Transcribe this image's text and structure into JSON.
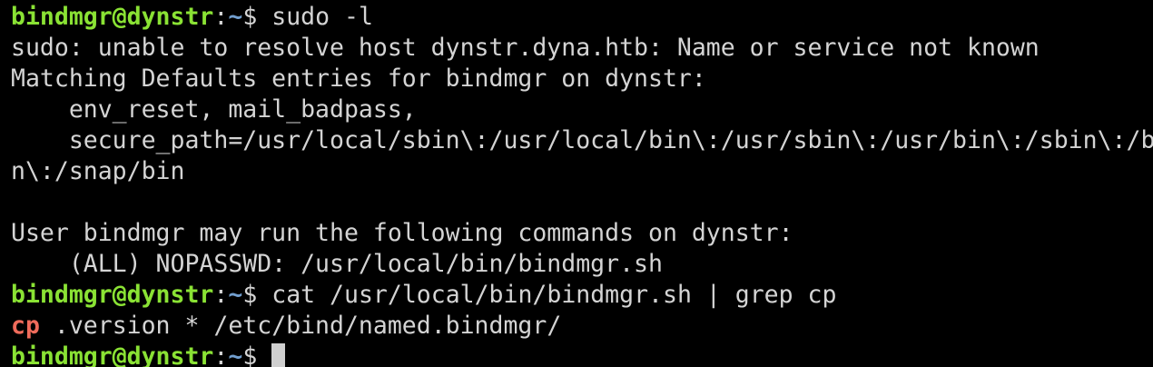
{
  "colors": {
    "background": "#000000",
    "text": "#d4d4d4",
    "prompt_user": "#8ae234",
    "prompt_path": "#729fcf",
    "highlight": "#ef6b5b"
  },
  "prompt": {
    "user_host": "bindmgr@dynstr",
    "colon": ":",
    "path": "~",
    "symbol": "$"
  },
  "lines": [
    {
      "type": "prompt",
      "command": " sudo -l"
    },
    {
      "type": "output",
      "text": "sudo: unable to resolve host dynstr.dyna.htb: Name or service not known"
    },
    {
      "type": "output",
      "text": "Matching Defaults entries for bindmgr on dynstr:"
    },
    {
      "type": "output",
      "text": "    env_reset, mail_badpass,"
    },
    {
      "type": "output",
      "text": "    secure_path=/usr/local/sbin\\:/usr/local/bin\\:/usr/sbin\\:/usr/bin\\:/sbin\\:/bi"
    },
    {
      "type": "output",
      "text": "n\\:/snap/bin"
    },
    {
      "type": "output",
      "text": ""
    },
    {
      "type": "output",
      "text": "User bindmgr may run the following commands on dynstr:"
    },
    {
      "type": "output",
      "text": "    (ALL) NOPASSWD: /usr/local/bin/bindmgr.sh"
    },
    {
      "type": "prompt",
      "command": " cat /usr/local/bin/bindmgr.sh | grep cp"
    },
    {
      "type": "grep",
      "match": "cp",
      "rest": " .version * /etc/bind/named.bindmgr/"
    },
    {
      "type": "prompt",
      "command": " "
    }
  ]
}
